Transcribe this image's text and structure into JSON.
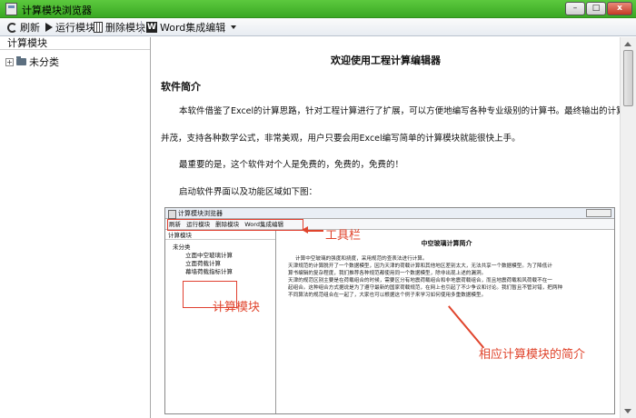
{
  "window": {
    "title": "计算模块浏览器",
    "min_glyph": "–",
    "max_glyph": "□",
    "close_glyph": "x"
  },
  "toolbar": {
    "refresh_label": "刷新",
    "run_label": "运行模块",
    "delete_label": "删除模块",
    "word_label": "Word集成编辑",
    "word_icon_glyph": "W"
  },
  "sidebar": {
    "header": "计算模块",
    "tree": [
      {
        "expander": "+",
        "label": "未分类"
      }
    ]
  },
  "document": {
    "title": "欢迎使用工程计算编辑器",
    "heading": "软件简介",
    "paragraphs": [
      "本软件借鉴了Excel的计算思路，针对工程计算进行了扩展，可以方便地编写各种专业级别的计算书。最终输出的计算书可以图文",
      "并茂，支持各种数学公式，非常美观，用户只要会用Excel编写简单的计算模块就能很快上手。",
      "最重要的是，这个软件对个人是免费的，免费的，免费的！",
      "启动软件界面以及功能区域如下图："
    ]
  },
  "embedded_screenshot": {
    "title": "计算模块浏览器",
    "toolbar_items": [
      "刷新",
      "运行模块",
      "删除模块",
      "Word集成编辑"
    ],
    "sidebar_header": "计算模块",
    "tree_root": "未分类",
    "tree_children": [
      "立面中空玻璃计算",
      "立面荷载计算",
      "幕墙荷载指标计算"
    ],
    "doc_title": "中空玻璃计算简介",
    "doc_lines": [
      "计算中空玻璃的强度和挠度，采用规范的查表法进行计算。",
      "天津规范的计算脱开了一个数据模型，因为天津的荷载计算和其他地区差别太大，无法共享一个数据模型。为了降低计",
      "算书编辑的复杂程度，我们推荐各种规范都使用同一个数据模型，除非出现上述的漏洞。",
      "天津的规范区别主要是在荷载组合的时候，需要区分有地震荷载组合和非地震荷载组合，而且地震荷载和风荷载不在一",
      "起组合。这种组合方式据说是为了遵守最新的国家荷载规范，在网上也引起了不少争议和讨论。我们暂且不管对错，把两种",
      "不同算法的规范组合在一起了，大家也可以根据这个例子来学习如何使用多重数据模型。"
    ],
    "annotations": {
      "toolbar": "工具栏",
      "modules": "计算模块",
      "summary": "相应计算模块的简介"
    }
  },
  "colors": {
    "titlebar": "#3aa823",
    "annotation": "#e0442c"
  }
}
